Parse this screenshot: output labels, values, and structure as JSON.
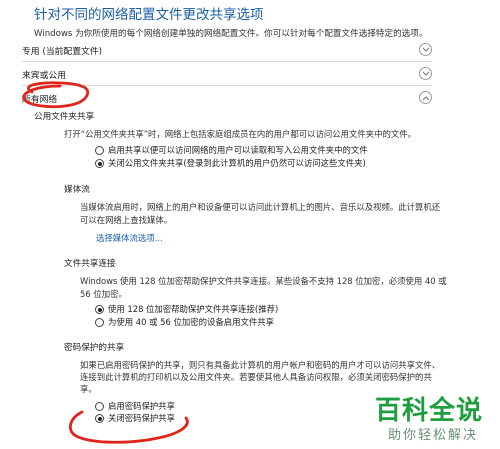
{
  "page": {
    "title": "针对不同的网络配置文件更改共享选项",
    "intro": "Windows 为你所使用的每个网络创建单独的网络配置文件。你可以针对每个配置文件选择特定的选项。"
  },
  "profiles": [
    {
      "label": "专用 (当前配置文件)",
      "state": "collapsed"
    },
    {
      "label": "来宾或公用",
      "state": "collapsed"
    },
    {
      "label": "所有网络",
      "state": "expanded"
    }
  ],
  "public_folder": {
    "heading": "公用文件夹共享",
    "description": "打开“公用文件夹共享”时，网络上包括家庭组成员在内的用户都可以访问公用文件夹中的文件。",
    "options": [
      {
        "label": "启用共享以便可以访问网络的用户可以读取和写入公用文件夹中的文件",
        "selected": false
      },
      {
        "label": "关闭公用文件夹共享(登录到此计算机的用户仍然可以访问这些文件夹)",
        "selected": true
      }
    ]
  },
  "media": {
    "heading": "媒体流",
    "description_line1": "当媒体流启用时，网络上的用户和设备便可以访问此计算机上的图片、音乐以及视频。此计算机还",
    "description_line2": "可以在网络上查找媒体。",
    "link": "选择媒体流选项..."
  },
  "file_sharing": {
    "heading": "文件共享连接",
    "description_line1": "Windows 使用 128 位加密帮助保护文件共享连接。某些设备不支持 128 位加密，必须使用 40 或",
    "description_line2": "56 位加密。",
    "options": [
      {
        "label": "使用 128 位加密帮助保护文件共享连接(推荐)",
        "selected": true
      },
      {
        "label": "为使用 40 或 56 位加密的设备启用文件共享",
        "selected": false
      }
    ]
  },
  "password": {
    "heading": "密码保护的共享",
    "description_line1": "如果已启用密码保护的共享，则只有具备此计算机的用户帐户和密码的用户才可以访问共享文件、",
    "description_line2": "连接到此计算机的打印机以及公用文件夹。若要使其他人具备访问权限，必须关闭密码保护的共",
    "description_line3": "享。",
    "options": [
      {
        "label": "启用密码保护共享",
        "selected": false
      },
      {
        "label": "关闭密码保护共享",
        "selected": true
      }
    ]
  },
  "watermark": {
    "main": "百科全说",
    "sub": "助你轻松解决"
  },
  "colors": {
    "title": "#1a5fa8",
    "annotation": "#e0241b",
    "watermark": "#1f9e3f"
  }
}
